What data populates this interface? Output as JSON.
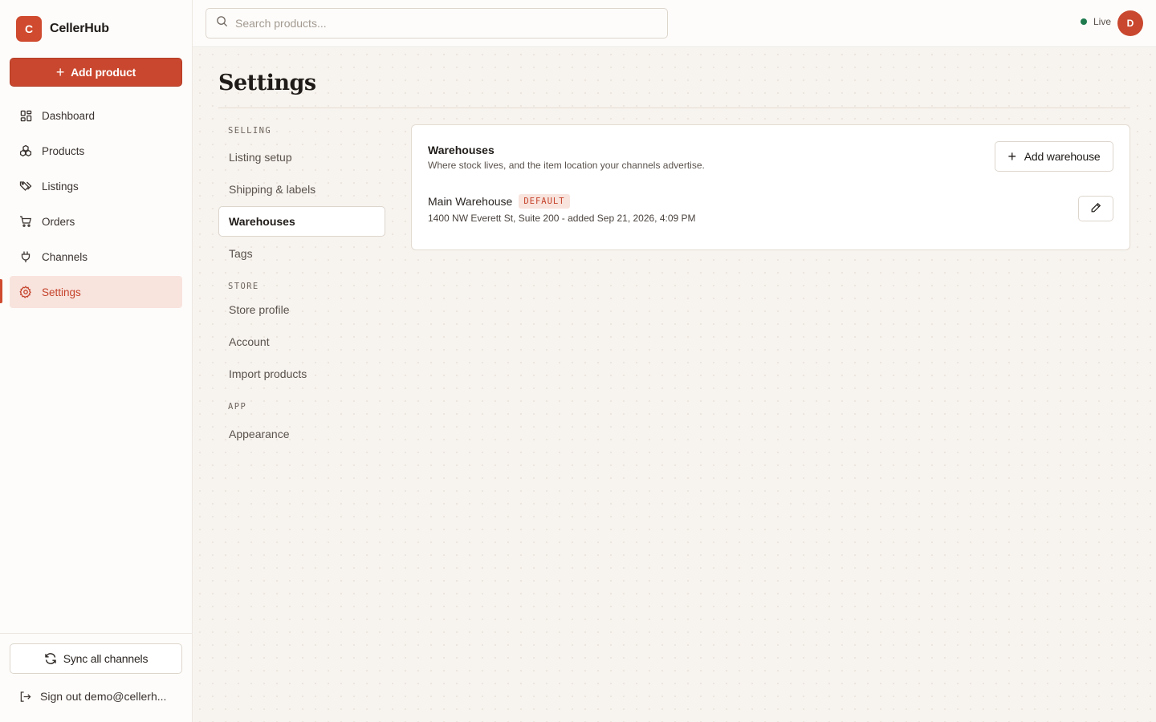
{
  "brand": {
    "logo_letter": "C",
    "name": "CellerHub",
    "accent": "#c9472e"
  },
  "sidebar": {
    "add_product_label": "Add product",
    "items": [
      {
        "label": "Dashboard",
        "icon": "dashboard-icon"
      },
      {
        "label": "Products",
        "icon": "products-icon"
      },
      {
        "label": "Listings",
        "icon": "tag-icon"
      },
      {
        "label": "Orders",
        "icon": "cart-icon"
      },
      {
        "label": "Channels",
        "icon": "plug-icon"
      },
      {
        "label": "Settings",
        "icon": "gear-icon",
        "active": true
      }
    ],
    "sync_label": "Sync all channels",
    "signout_label": "Sign out demo@cellerh..."
  },
  "topbar": {
    "search_placeholder": "Search products...",
    "status_label": "Live",
    "status_color": "#1f7a4e",
    "avatar_letter": "D"
  },
  "page": {
    "title": "Settings"
  },
  "settings_nav": {
    "groups": [
      {
        "label": "SELLING",
        "items": [
          "Listing setup",
          "Shipping & labels",
          "Warehouses",
          "Tags"
        ]
      },
      {
        "label": "STORE",
        "items": [
          "Store profile",
          "Account",
          "Import products"
        ]
      },
      {
        "label": "APP",
        "items": [
          "Appearance"
        ]
      }
    ],
    "active": "Warehouses"
  },
  "warehouses": {
    "title": "Warehouses",
    "subtitle": "Where stock lives, and the item location your channels advertise.",
    "add_label": "Add warehouse",
    "rows": [
      {
        "name": "Main Warehouse",
        "badge": "DEFAULT",
        "meta": "1400 NW Everett St, Suite 200 - added Sep 21, 2026, 4:09 PM"
      }
    ]
  }
}
